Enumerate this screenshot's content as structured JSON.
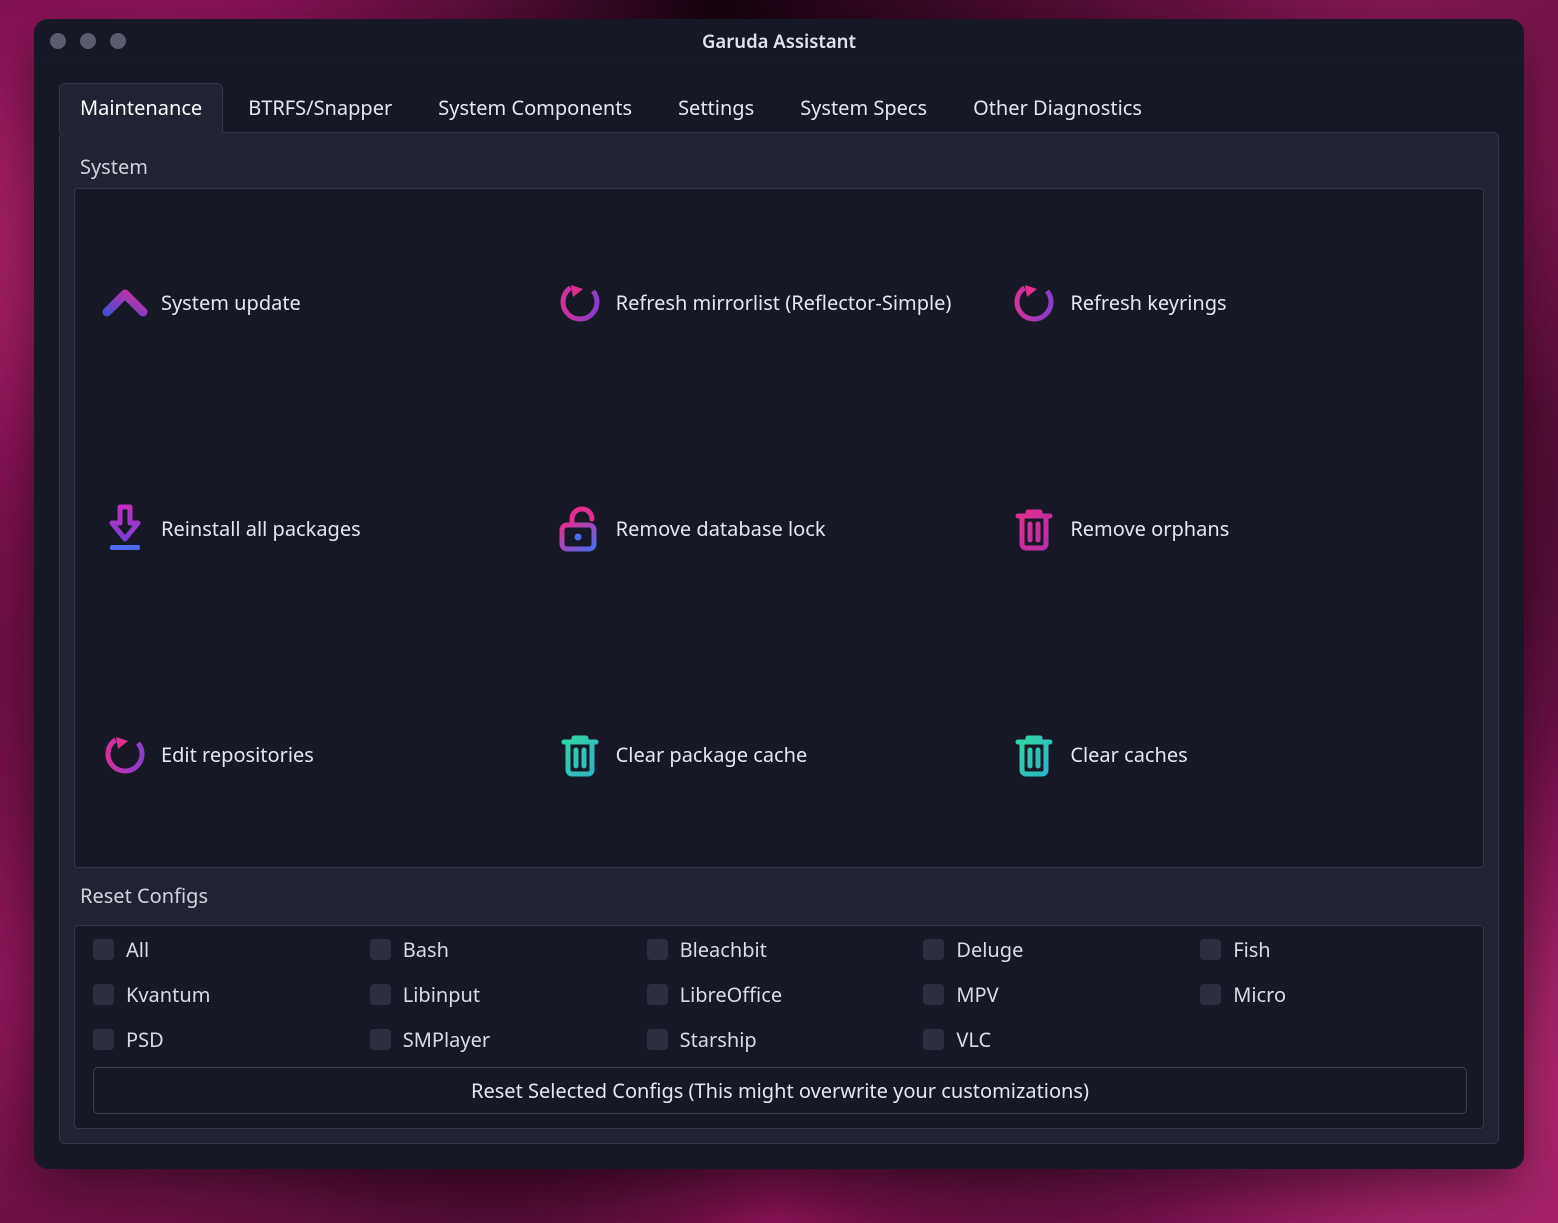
{
  "title": "Garuda Assistant",
  "tabs": [
    {
      "label": "Maintenance",
      "active": true
    },
    {
      "label": "BTRFS/Snapper",
      "active": false
    },
    {
      "label": "System Components",
      "active": false
    },
    {
      "label": "Settings",
      "active": false
    },
    {
      "label": "System Specs",
      "active": false
    },
    {
      "label": "Other Diagnostics",
      "active": false
    }
  ],
  "groups": {
    "system": {
      "title": "System",
      "actions": [
        {
          "icon": "chevron-up",
          "label": "System update"
        },
        {
          "icon": "refresh",
          "label": "Refresh mirrorlist (Reflector-Simple)"
        },
        {
          "icon": "refresh",
          "label": "Refresh keyrings"
        },
        {
          "icon": "download",
          "label": "Reinstall all packages"
        },
        {
          "icon": "lock-open",
          "label": "Remove database lock"
        },
        {
          "icon": "trash-pink",
          "label": "Remove orphans"
        },
        {
          "icon": "refresh",
          "label": "Edit repositories"
        },
        {
          "icon": "trash-green",
          "label": "Clear package cache"
        },
        {
          "icon": "trash-green",
          "label": "Clear caches"
        }
      ]
    },
    "reset": {
      "title": "Reset Configs",
      "items": [
        "All",
        "Bash",
        "Bleachbit",
        "Deluge",
        "Fish",
        "Kvantum",
        "Libinput",
        "LibreOffice",
        "MPV",
        "Micro",
        "PSD",
        "SMPlayer",
        "Starship",
        "VLC"
      ],
      "button": "Reset Selected Configs (This might overwrite your customizations)"
    }
  },
  "colors": {
    "magenta": "#e22f8e",
    "purple": "#7a3fd5",
    "teal": "#30d6a1",
    "blue": "#4d6af0"
  }
}
